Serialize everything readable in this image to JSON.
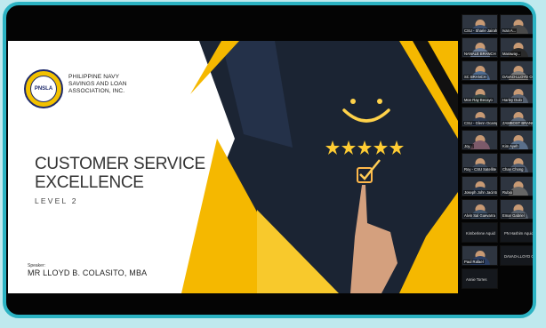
{
  "slide": {
    "org_line1": "PHILIPPINE NAVY",
    "org_line2": "SAVINGS AND LOAN",
    "org_line3": "ASSOCIATION, INC.",
    "title_line1": "CUSTOMER SERVICE",
    "title_line2": "EXCELLENCE",
    "level": "LEVEL 2",
    "speaker_label": "Speaker:",
    "speaker_name": "MR LLOYD B. COLASITO, MBA",
    "logo_text": "PNSLA",
    "colors": {
      "accent": "#f5b800",
      "frame": "#2bb3c3",
      "dark_panel": "#1b2433"
    }
  },
  "participants": [
    {
      "name": "CSU - Sharie Jairah B.",
      "shirt": "#3b4f6e"
    },
    {
      "name": "Ivan A...",
      "shirt": "#4a4a4a"
    },
    {
      "name": "NANALE BRANCH",
      "shirt": "#6b7d99"
    },
    {
      "name": "Maraway...",
      "shirt": "#2a2a2a"
    },
    {
      "name": "SC BRANCH",
      "shirt": "#4f6b8f"
    },
    {
      "name": "DAVAO-LLOYD CO",
      "shirt": "#7a7a7a"
    },
    {
      "name": "Mon Ray Becayo",
      "shirt": "#344"
    },
    {
      "name": "Harley Dulo",
      "shirt": "#556070"
    },
    {
      "name": "CSU - Glenn Ocampo",
      "shirt": "#2f3b52"
    },
    {
      "name": "ZAMBOST BRANCH",
      "shirt": "#5d6a7c"
    },
    {
      "name": "Joy...",
      "shirt": "#7c5a6a"
    },
    {
      "name": "Kim Ayeh",
      "shirt": "#5a6f8a"
    },
    {
      "name": "Roy - CSU Satellite Office",
      "shirt": "#3d4a5c"
    },
    {
      "name": "Chan Chong",
      "shirt": "#4d5a6e"
    },
    {
      "name": "Joseph John Jacinto",
      "shirt": "#2b3a4f"
    },
    {
      "name": "Rubio",
      "shirt": "#666"
    },
    {
      "name": "Alvin Sal Guevarra",
      "shirt": "#3f5268"
    },
    {
      "name": "Emar Gabriel",
      "shirt": "#58606b"
    },
    {
      "name": "Kimberlene Aquid",
      "shirt": "#222"
    },
    {
      "name": "PN Hashim Aquid",
      "shirt": "#222"
    },
    {
      "name": "Paul Rafael",
      "shirt": "#2b3e63"
    },
    {
      "name": "DAVAO-LLOYD CO",
      "shirt": "#222"
    },
    {
      "name": "Annie Torres",
      "shirt": "#222"
    }
  ]
}
